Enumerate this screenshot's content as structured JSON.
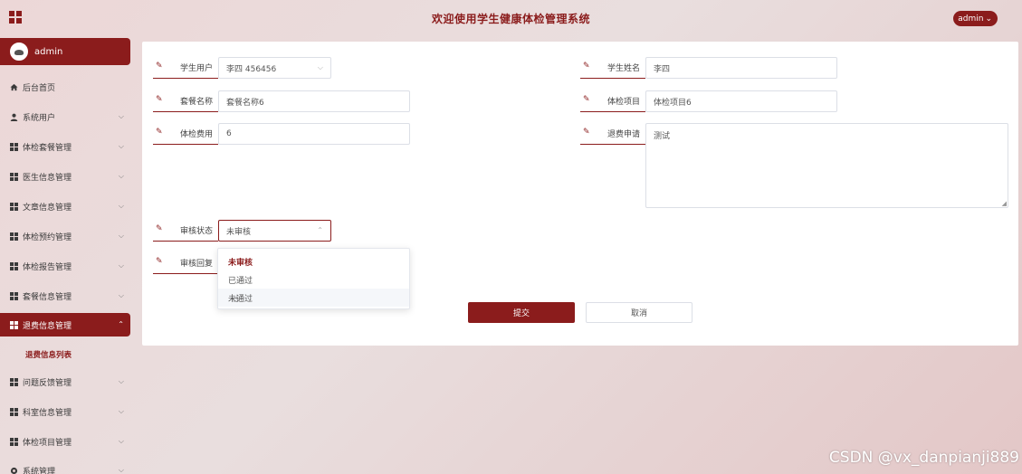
{
  "header": {
    "title": "欢迎使用学生健康体检管理系统",
    "user_menu": "admin",
    "user_menu_chevron": "⌄"
  },
  "sidebar": {
    "username": "admin",
    "items": [
      {
        "label": "后台首页",
        "icon": "home-icon",
        "has_chevron": false
      },
      {
        "label": "系统用户",
        "icon": "user-icon",
        "has_chevron": true
      },
      {
        "label": "体检套餐管理",
        "icon": "grid-icon",
        "has_chevron": true
      },
      {
        "label": "医生信息管理",
        "icon": "grid-icon",
        "has_chevron": true
      },
      {
        "label": "文章信息管理",
        "icon": "grid-icon",
        "has_chevron": true
      },
      {
        "label": "体检预约管理",
        "icon": "grid-icon",
        "has_chevron": true
      },
      {
        "label": "体检报告管理",
        "icon": "grid-icon",
        "has_chevron": true
      },
      {
        "label": "套餐信息管理",
        "icon": "grid-icon",
        "has_chevron": true
      },
      {
        "label": "退费信息管理",
        "icon": "grid-icon",
        "has_chevron": true,
        "active": true
      },
      {
        "label": "问题反馈管理",
        "icon": "grid-icon",
        "has_chevron": true
      },
      {
        "label": "科室信息管理",
        "icon": "grid-icon",
        "has_chevron": true
      },
      {
        "label": "体检项目管理",
        "icon": "grid-icon",
        "has_chevron": true
      },
      {
        "label": "系统管理",
        "icon": "gear-icon",
        "has_chevron": true
      }
    ],
    "sub_item": "退费信息列表"
  },
  "form": {
    "student_user": {
      "label": "学生用户",
      "value": "李四 456456"
    },
    "student_name": {
      "label": "学生姓名",
      "value": "李四"
    },
    "package_name": {
      "label": "套餐名称",
      "value": "套餐名称6"
    },
    "exam_item": {
      "label": "体检项目",
      "value": "体检项目6"
    },
    "exam_fee": {
      "label": "体检费用",
      "value": "6"
    },
    "refund_request": {
      "label": "退费申请",
      "value": "测试"
    },
    "review_status": {
      "label": "审核状态",
      "value": "未审核"
    },
    "review_reply": {
      "label": "审核回复"
    }
  },
  "dropdown": {
    "options": [
      "未审核",
      "已通过",
      "未通过"
    ],
    "selected": "未审核"
  },
  "buttons": {
    "submit": "提交",
    "cancel": "取消"
  },
  "watermark": "CSDN @vx_danpianji889",
  "colors": {
    "accent": "#8b1c1c"
  }
}
